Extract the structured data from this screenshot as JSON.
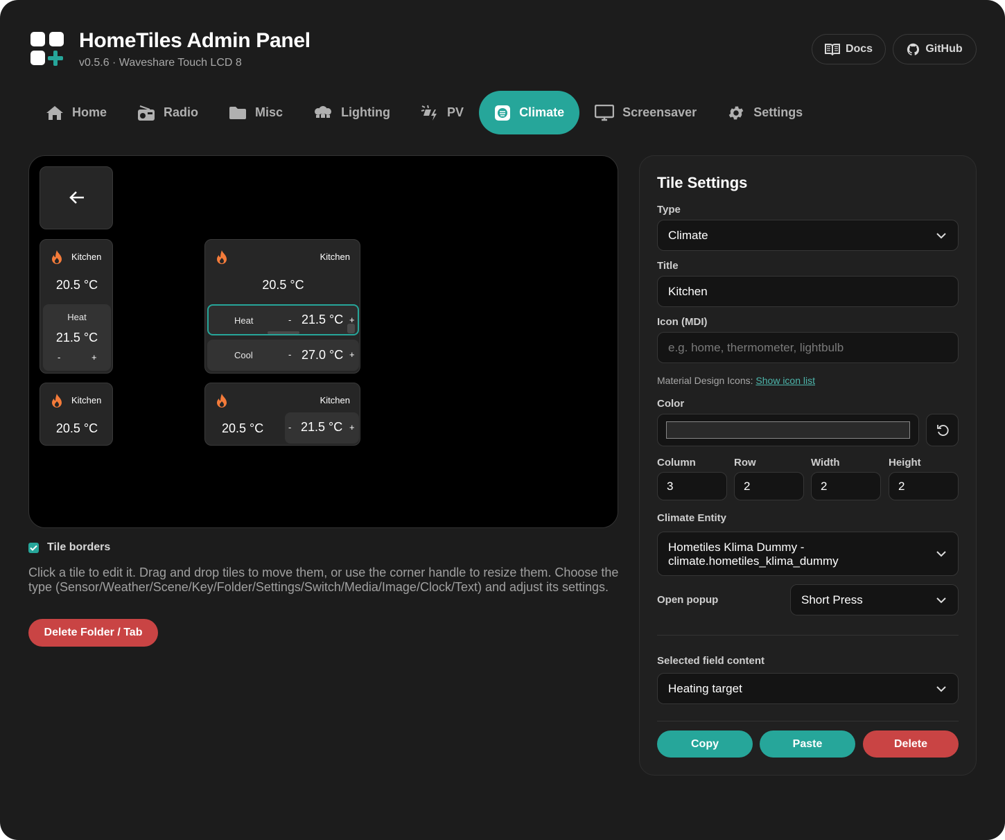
{
  "app": {
    "title": "HomeTiles Admin Panel",
    "subtitle": "v0.5.6 · Waveshare Touch LCD 8",
    "docs_label": "Docs",
    "github_label": "GitHub"
  },
  "tabs": [
    {
      "label": "Home",
      "icon": "home-icon"
    },
    {
      "label": "Radio",
      "icon": "radio-icon"
    },
    {
      "label": "Misc",
      "icon": "folder-icon"
    },
    {
      "label": "Lighting",
      "icon": "lightbulb-group-icon"
    },
    {
      "label": "PV",
      "icon": "solar-power-icon"
    },
    {
      "label": "Climate",
      "icon": "climate-icon",
      "active": true
    },
    {
      "label": "Screensaver",
      "icon": "monitor-icon"
    },
    {
      "label": "Settings",
      "icon": "gear-icon"
    }
  ],
  "preview": {
    "tile_small_1": {
      "title": "Kitchen",
      "temp": "20.5 °C",
      "mode": "Heat",
      "target": "21.5 °C",
      "minus": "-",
      "plus": "+"
    },
    "tile_small_2": {
      "title": "Kitchen",
      "temp": "20.5 °C"
    },
    "tile_large": {
      "title": "Kitchen",
      "temp": "20.5 °C",
      "heat_label": "Heat",
      "heat_target": "21.5 °C",
      "cool_label": "Cool",
      "cool_target": "27.0 °C",
      "minus": "-",
      "plus": "+"
    },
    "tile_wide": {
      "title": "Kitchen",
      "temp": "20.5 °C",
      "target": "21.5 °C",
      "minus": "-",
      "plus": "+"
    }
  },
  "editor": {
    "tile_borders_label": "Tile borders",
    "tile_borders_checked": true,
    "help_text": "Click a tile to edit it. Drag and drop tiles to move them, or use the corner handle to resize them. Choose the type (Sensor/Weather/Scene/Key/Folder/Settings/Switch/Media/Image/Clock/Text) and adjust its settings.",
    "delete_folder_label": "Delete Folder / Tab"
  },
  "panel": {
    "title": "Tile Settings",
    "type_label": "Type",
    "type_value": "Climate",
    "title_label": "Title",
    "title_value": "Kitchen",
    "icon_label": "Icon (MDI)",
    "icon_placeholder": "e.g. home, thermometer, lightbulb",
    "icon_hint": "Material Design Icons:",
    "icon_hint_link": "Show icon list",
    "color_label": "Color",
    "color_value": "#2a2a2a",
    "column_label": "Column",
    "column_value": "3",
    "row_label": "Row",
    "row_value": "2",
    "width_label": "Width",
    "width_value": "2",
    "height_label": "Height",
    "height_value": "2",
    "entity_label": "Climate Entity",
    "entity_value_1": "Hometiles Klima Dummy -",
    "entity_value_2": "climate.hometiles_klima_dummy",
    "popup_label": "Open popup",
    "popup_value": "Short Press",
    "field_content_label": "Selected field content",
    "field_content_value": "Heating target",
    "copy_label": "Copy",
    "paste_label": "Paste",
    "delete_label": "Delete"
  },
  "colors": {
    "accent": "#26a69a",
    "danger": "#c94444",
    "flame": "#f47b3a"
  }
}
